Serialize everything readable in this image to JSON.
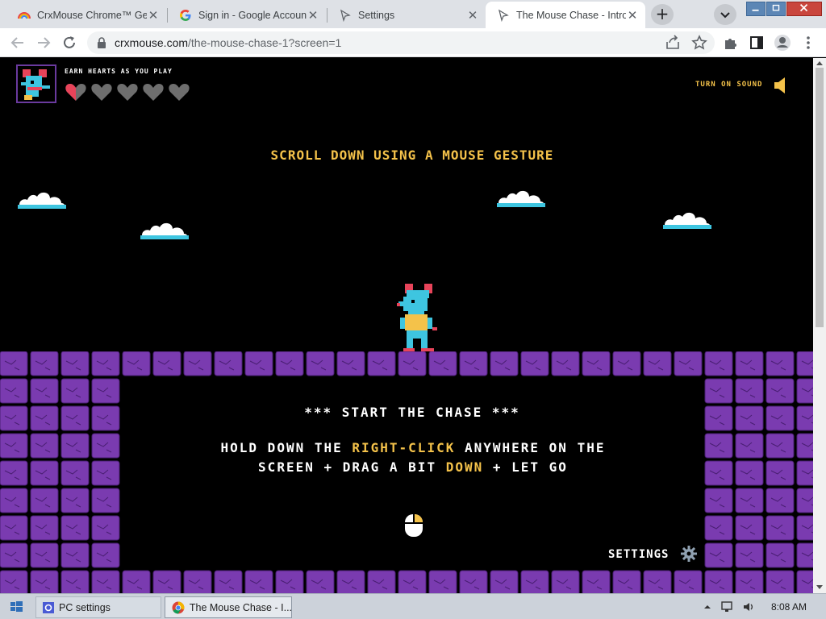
{
  "browser": {
    "tabs": [
      {
        "title": "CrxMouse Chrome™ Gest",
        "active": false
      },
      {
        "title": "Sign in - Google Account",
        "active": false
      },
      {
        "title": "Settings",
        "active": false
      },
      {
        "title": "The Mouse Chase - Intro",
        "active": true
      }
    ],
    "new_tab_label": "+",
    "url_host": "crxmouse.com",
    "url_path": "/the-mouse-chase-1?screen=1"
  },
  "game": {
    "earn_hearts_label": "EARN HEARTS AS YOU PLAY",
    "hearts_total": 5,
    "hearts_filled": 0.5,
    "sound_label": "TURN ON SOUND",
    "headline": "SCROLL DOWN USING A MOUSE GESTURE",
    "chase_title": "*** START THE CHASE ***",
    "instruction_line1_a": "HOLD DOWN THE ",
    "instruction_line1_hl": "RIGHT-CLICK",
    "instruction_line1_b": " ANYWHERE ON THE",
    "instruction_line2_a": "SCREEN + DRAG A BIT ",
    "instruction_line2_hl": "DOWN",
    "instruction_line2_b": " + LET GO",
    "settings_label": "SETTINGS",
    "accent_color": "#f4c24a",
    "brick_color": "#7a3bb0"
  },
  "taskbar": {
    "items": [
      {
        "label": "PC settings"
      },
      {
        "label": "The Mouse Chase - I..."
      }
    ],
    "clock": "8:08 AM"
  }
}
